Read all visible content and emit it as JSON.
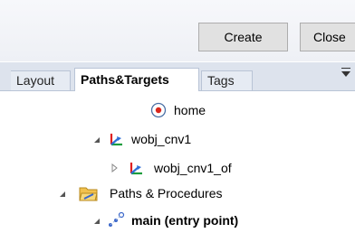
{
  "toolbar": {
    "create_label": "Create",
    "close_label": "Close"
  },
  "tabs": [
    {
      "label": "Layout",
      "selected": false
    },
    {
      "label": "Paths&Targets",
      "selected": true
    },
    {
      "label": "Tags",
      "selected": false
    }
  ],
  "tree": {
    "items": [
      {
        "label": "home",
        "icon": "target-circle-icon",
        "expanded": null,
        "bold": false
      },
      {
        "label": "wobj_cnv1",
        "icon": "workobject-frame-icon",
        "expanded": true,
        "bold": false
      },
      {
        "label": "wobj_cnv1_of",
        "icon": "workobject-frame-icon",
        "expanded": false,
        "bold": false
      },
      {
        "label": "Paths & Procedures",
        "icon": "folder-icon",
        "expanded": true,
        "bold": false
      },
      {
        "label": "main (entry point)",
        "icon": "path-icon",
        "expanded": true,
        "bold": true
      }
    ]
  },
  "colors": {
    "toolbar_bg": "#eef0f5",
    "tabstrip_bg": "#dde3ed",
    "button_bg": "#e1e1e1",
    "target_red": "#d9261c",
    "axis_red": "#e02020",
    "axis_green": "#1a9c3c",
    "axis_blue": "#2f6fd6",
    "folder_yellow": "#f2c14e"
  }
}
